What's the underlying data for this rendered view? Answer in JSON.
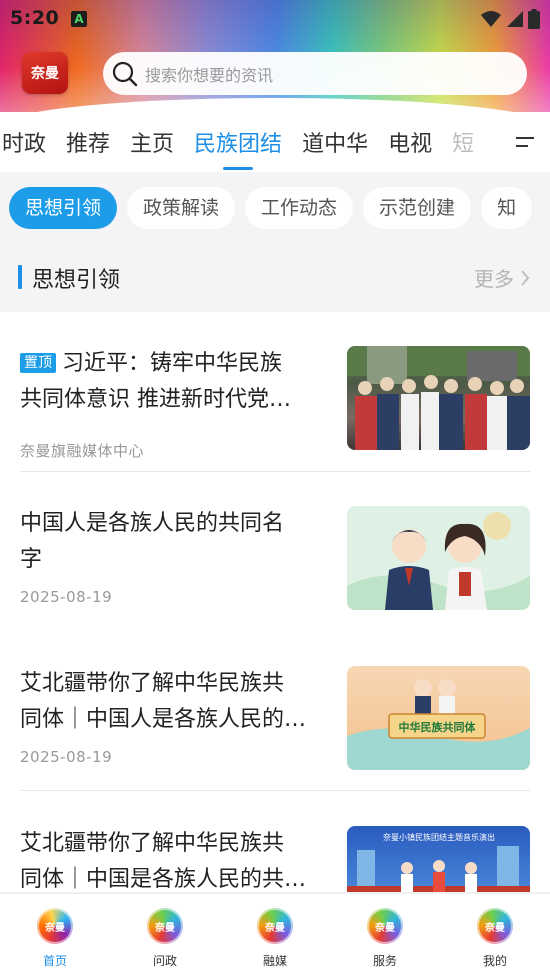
{
  "status_bar": {
    "time": "5:20",
    "notification_letter": "A",
    "icons": [
      "wifi-icon",
      "signal-icon",
      "battery-icon"
    ]
  },
  "header": {
    "logo_text": "奈曼",
    "search_placeholder": "搜索你想要的资讯"
  },
  "categories": {
    "items": [
      "时政",
      "推荐",
      "主页",
      "民族团结",
      "道中华",
      "电视",
      "短"
    ],
    "active": "民族团结"
  },
  "sub_tabs": {
    "items": [
      "思想引领",
      "政策解读",
      "工作动态",
      "示范创建",
      "知"
    ],
    "active": "思想引领"
  },
  "section": {
    "title": "思想引领",
    "more_label": "更多"
  },
  "news": [
    {
      "badge": "置顶",
      "title_line1": "习近平：铸牢中华民族",
      "title_line2": "共同体意识  推进新时代党…",
      "meta": "奈曼旗融媒体中心"
    },
    {
      "badge": "",
      "title_line1": "中国人是各族人民的共同名",
      "title_line2": "字",
      "meta": "2025-08-19"
    },
    {
      "badge": "",
      "title_line1": "艾北疆带你了解中华民族共",
      "title_line2": "同体｜中国人是各族人民的…",
      "meta": "2025-08-19"
    },
    {
      "badge": "",
      "title_line1": "艾北疆带你了解中华民族共",
      "title_line2": "同体｜中国是各族人民的共…",
      "meta": ""
    }
  ],
  "thumb_text": {
    "item3_banner": "中华民族共同体",
    "item4_banner": "奈曼小镇民族团结主题音乐演出"
  },
  "bottom_nav": {
    "items": [
      "首页",
      "问政",
      "融媒",
      "服务",
      "我的"
    ],
    "icon_text": "奈曼",
    "active": "首页"
  },
  "colors": {
    "accent": "#1d8fe8",
    "chip_active": "#1d9ce8"
  }
}
